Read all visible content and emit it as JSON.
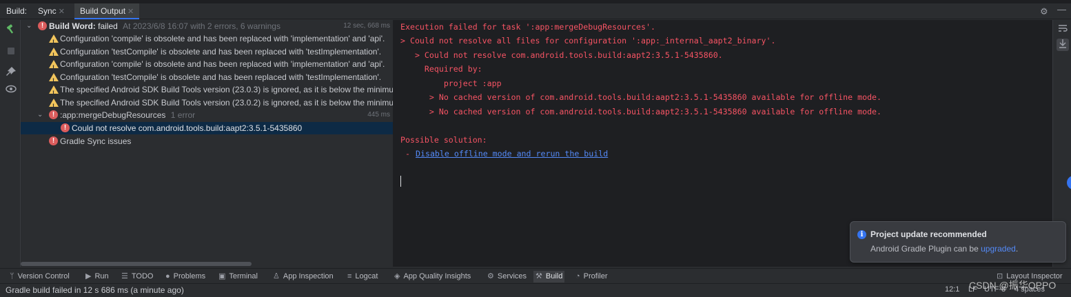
{
  "tool_window": {
    "title": "Build:",
    "tabs": [
      {
        "label": "Sync"
      },
      {
        "label": "Build Output"
      }
    ],
    "gear_icon": "gear-icon",
    "minimize_icon": "minimize-icon"
  },
  "tree": {
    "root": {
      "label": "Build Word:",
      "status": "failed",
      "meta": "At 2023/6/8 16:07 with 2 errors, 6 warnings",
      "time": "12 sec, 668 ms"
    },
    "warnings": [
      "Configuration 'compile' is obsolete and has been replaced with 'implementation' and 'api'.",
      "Configuration 'testCompile' is obsolete and has been replaced with 'testImplementation'.",
      "Configuration 'compile' is obsolete and has been replaced with 'implementation' and 'api'.",
      "Configuration 'testCompile' is obsolete and has been replaced with 'testImplementation'.",
      "The specified Android SDK Build Tools version (23.0.3) is ignored, as it is below the minimu",
      "The specified Android SDK Build Tools version (23.0.2) is ignored, as it is below the minimu"
    ],
    "task": {
      "label": ":app:mergeDebugResources",
      "meta": "1 error",
      "time": "445 ms"
    },
    "task_error": "Could not resolve com.android.tools.build:aapt2:3.5.1-5435860",
    "sync_issue": "Gradle Sync issues"
  },
  "console": {
    "lines": [
      "Execution failed for task ':app:mergeDebugResources'.",
      "> Could not resolve all files for configuration ':app:_internal_aapt2_binary'.",
      "   > Could not resolve com.android.tools.build:aapt2:3.5.1-5435860.",
      "     Required by:",
      "         project :app",
      "      > No cached version of com.android.tools.build:aapt2:3.5.1-5435860 available for offline mode.",
      "      > No cached version of com.android.tools.build:aapt2:3.5.1-5435860 available for offline mode.",
      "Possible solution:",
      " - "
    ],
    "solution_link": "Disable offline mode and rerun the build"
  },
  "notification": {
    "title": "Project update recommended",
    "body": "Android Gradle Plugin can be ",
    "link": "upgraded",
    "suffix": "."
  },
  "tool_stripe": [
    {
      "label": "Version Control",
      "icon": "version-control-icon"
    },
    {
      "label": "Run",
      "icon": "run-icon"
    },
    {
      "label": "TODO",
      "icon": "todo-icon"
    },
    {
      "label": "Problems",
      "icon": "problems-icon"
    },
    {
      "label": "Terminal",
      "icon": "terminal-icon"
    },
    {
      "label": "App Inspection",
      "icon": "app-inspection-icon"
    },
    {
      "label": "Logcat",
      "icon": "logcat-icon"
    },
    {
      "label": "App Quality Insights",
      "icon": "app-quality-icon"
    },
    {
      "label": "Services",
      "icon": "services-icon"
    },
    {
      "label": "Build",
      "icon": "hammer-icon",
      "active": true
    },
    {
      "label": "Profiler",
      "icon": "profiler-icon"
    }
  ],
  "layout_inspector": "Layout Inspector",
  "status_bar": {
    "message": "Gradle build failed in 12 s 686 ms (a minute ago)",
    "position": "12:1",
    "line_sep": "LF",
    "encoding": "UTF-8",
    "indent": "4 spaces"
  },
  "watermark": "CSDN @振华OPPO",
  "colors": {
    "error": "#f75464",
    "link": "#548af7",
    "accent": "#3574f0",
    "warning": "#f2c55c"
  }
}
